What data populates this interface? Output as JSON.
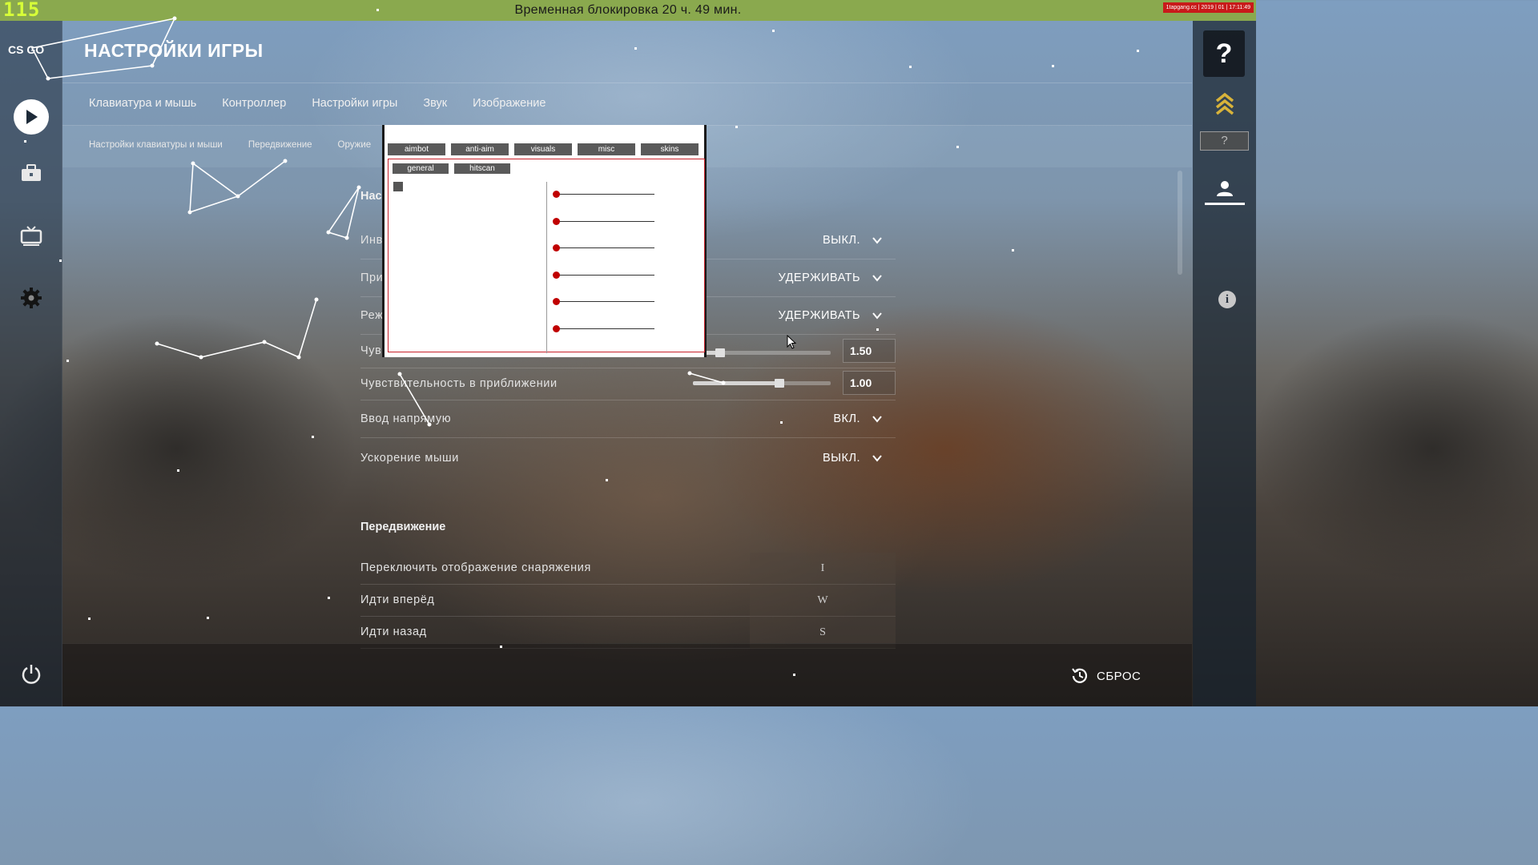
{
  "topbar": {
    "fps": "115",
    "ban_text": "Временная блокировка 20 ч. 49 мин.",
    "watermark": "1tapgang.cc | 2019 | 01 | 17:11:49"
  },
  "sidebar": {
    "logo": "CS GO",
    "items": [
      "play-icon",
      "briefcase-icon",
      "tv-icon",
      "gear-icon",
      "power-icon"
    ]
  },
  "header": {
    "title": "НАСТРОЙКИ ИГРЫ",
    "tabs": [
      "Клавиатура и мышь",
      "Контроллер",
      "Настройки игры",
      "Звук",
      "Изображение"
    ],
    "subtabs": [
      "Настройки клавиатуры и мыши",
      "Передвижение",
      "Оружие"
    ]
  },
  "settings": {
    "section_mouse": "Нас",
    "rows": [
      {
        "label": "Инв",
        "value": "ВЫКЛ."
      },
      {
        "label": "При",
        "value": "УДЕРЖИВАТЬ"
      },
      {
        "label": "Реж",
        "value": "УДЕРЖИВАТЬ"
      }
    ],
    "sensitivity": {
      "label": "Чув",
      "value": "1.50",
      "level": 0.2
    },
    "zoom_sensitivity": {
      "label": "Чувствительность в приближении",
      "value": "1.00",
      "level": 0.63
    },
    "raw_input": {
      "label": "Ввод напрямую",
      "value": "ВКЛ."
    },
    "mouse_accel": {
      "label": "Ускорение мыши",
      "value": "ВЫКЛ."
    },
    "section_movement": "Передвижение",
    "keybinds": [
      {
        "label": "Переключить отображение снаряжения",
        "key": "I"
      },
      {
        "label": "Идти вперёд",
        "key": "W"
      },
      {
        "label": "Идти назад",
        "key": "S"
      }
    ]
  },
  "footer": {
    "reset_label": "СБРОС"
  },
  "rightbar": {
    "help": "?",
    "rank_unknown": "?",
    "info": "i"
  },
  "cheat_menu": {
    "tabs": [
      "aimbot",
      "anti-aim",
      "visuals",
      "misc",
      "skins"
    ],
    "subtabs": [
      "general",
      "hitscan"
    ],
    "slider_count": 6
  }
}
